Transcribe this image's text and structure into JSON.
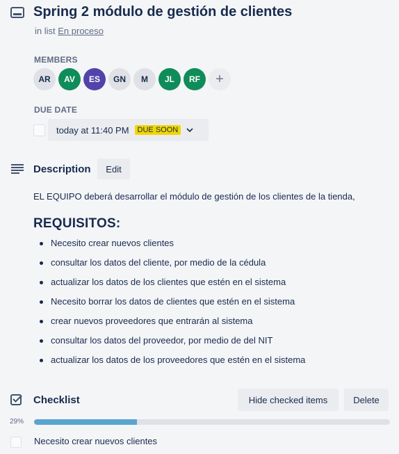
{
  "card": {
    "title": "Spring 2 módulo de gestión de clientes",
    "in_list_prefix": "in list",
    "list_name": "En proceso"
  },
  "members": {
    "label": "MEMBERS",
    "avatars": [
      {
        "initials": "AR",
        "color": "#dfe1e6"
      },
      {
        "initials": "AV",
        "color": "#0f8c59"
      },
      {
        "initials": "ES",
        "color": "#5243aa"
      },
      {
        "initials": "GN",
        "color": "#dfe1e6"
      },
      {
        "initials": "M",
        "color": "#dfe1e6"
      },
      {
        "initials": "JL",
        "color": "#0f8c59"
      },
      {
        "initials": "RF",
        "color": "#0f8c59"
      }
    ],
    "add_symbol": "+"
  },
  "due_date": {
    "label": "DUE DATE",
    "value": "today at 11:40 PM",
    "badge": "DUE SOON",
    "badge_color": "#f2d600"
  },
  "description": {
    "heading": "Description",
    "edit_label": "Edit",
    "text": "EL EQUIPO deberá desarrollar el módulo de gestión de los clientes de la tienda,",
    "requirements_heading": "REQUISITOS:",
    "requirements": [
      "Necesito crear nuevos clientes",
      "consultar los datos del cliente, por medio de la cédula",
      "actualizar los datos de los clientes que estén en el sistema",
      "Necesito borrar los datos de clientes que estén en el sistema",
      "crear nuevos proveedores que entrarán al sistema",
      "consultar los datos del proveedor, por medio de del NIT",
      "actualizar los datos de los proveedores que estén en el sistema"
    ]
  },
  "checklist": {
    "heading": "Checklist",
    "hide_label": "Hide checked items",
    "delete_label": "Delete",
    "progress_text": "29%",
    "progress_fraction": 0.29,
    "progress_color": "#5ba4cf",
    "items": [
      {
        "text": "Necesito crear nuevos clientes",
        "checked": false
      }
    ]
  }
}
